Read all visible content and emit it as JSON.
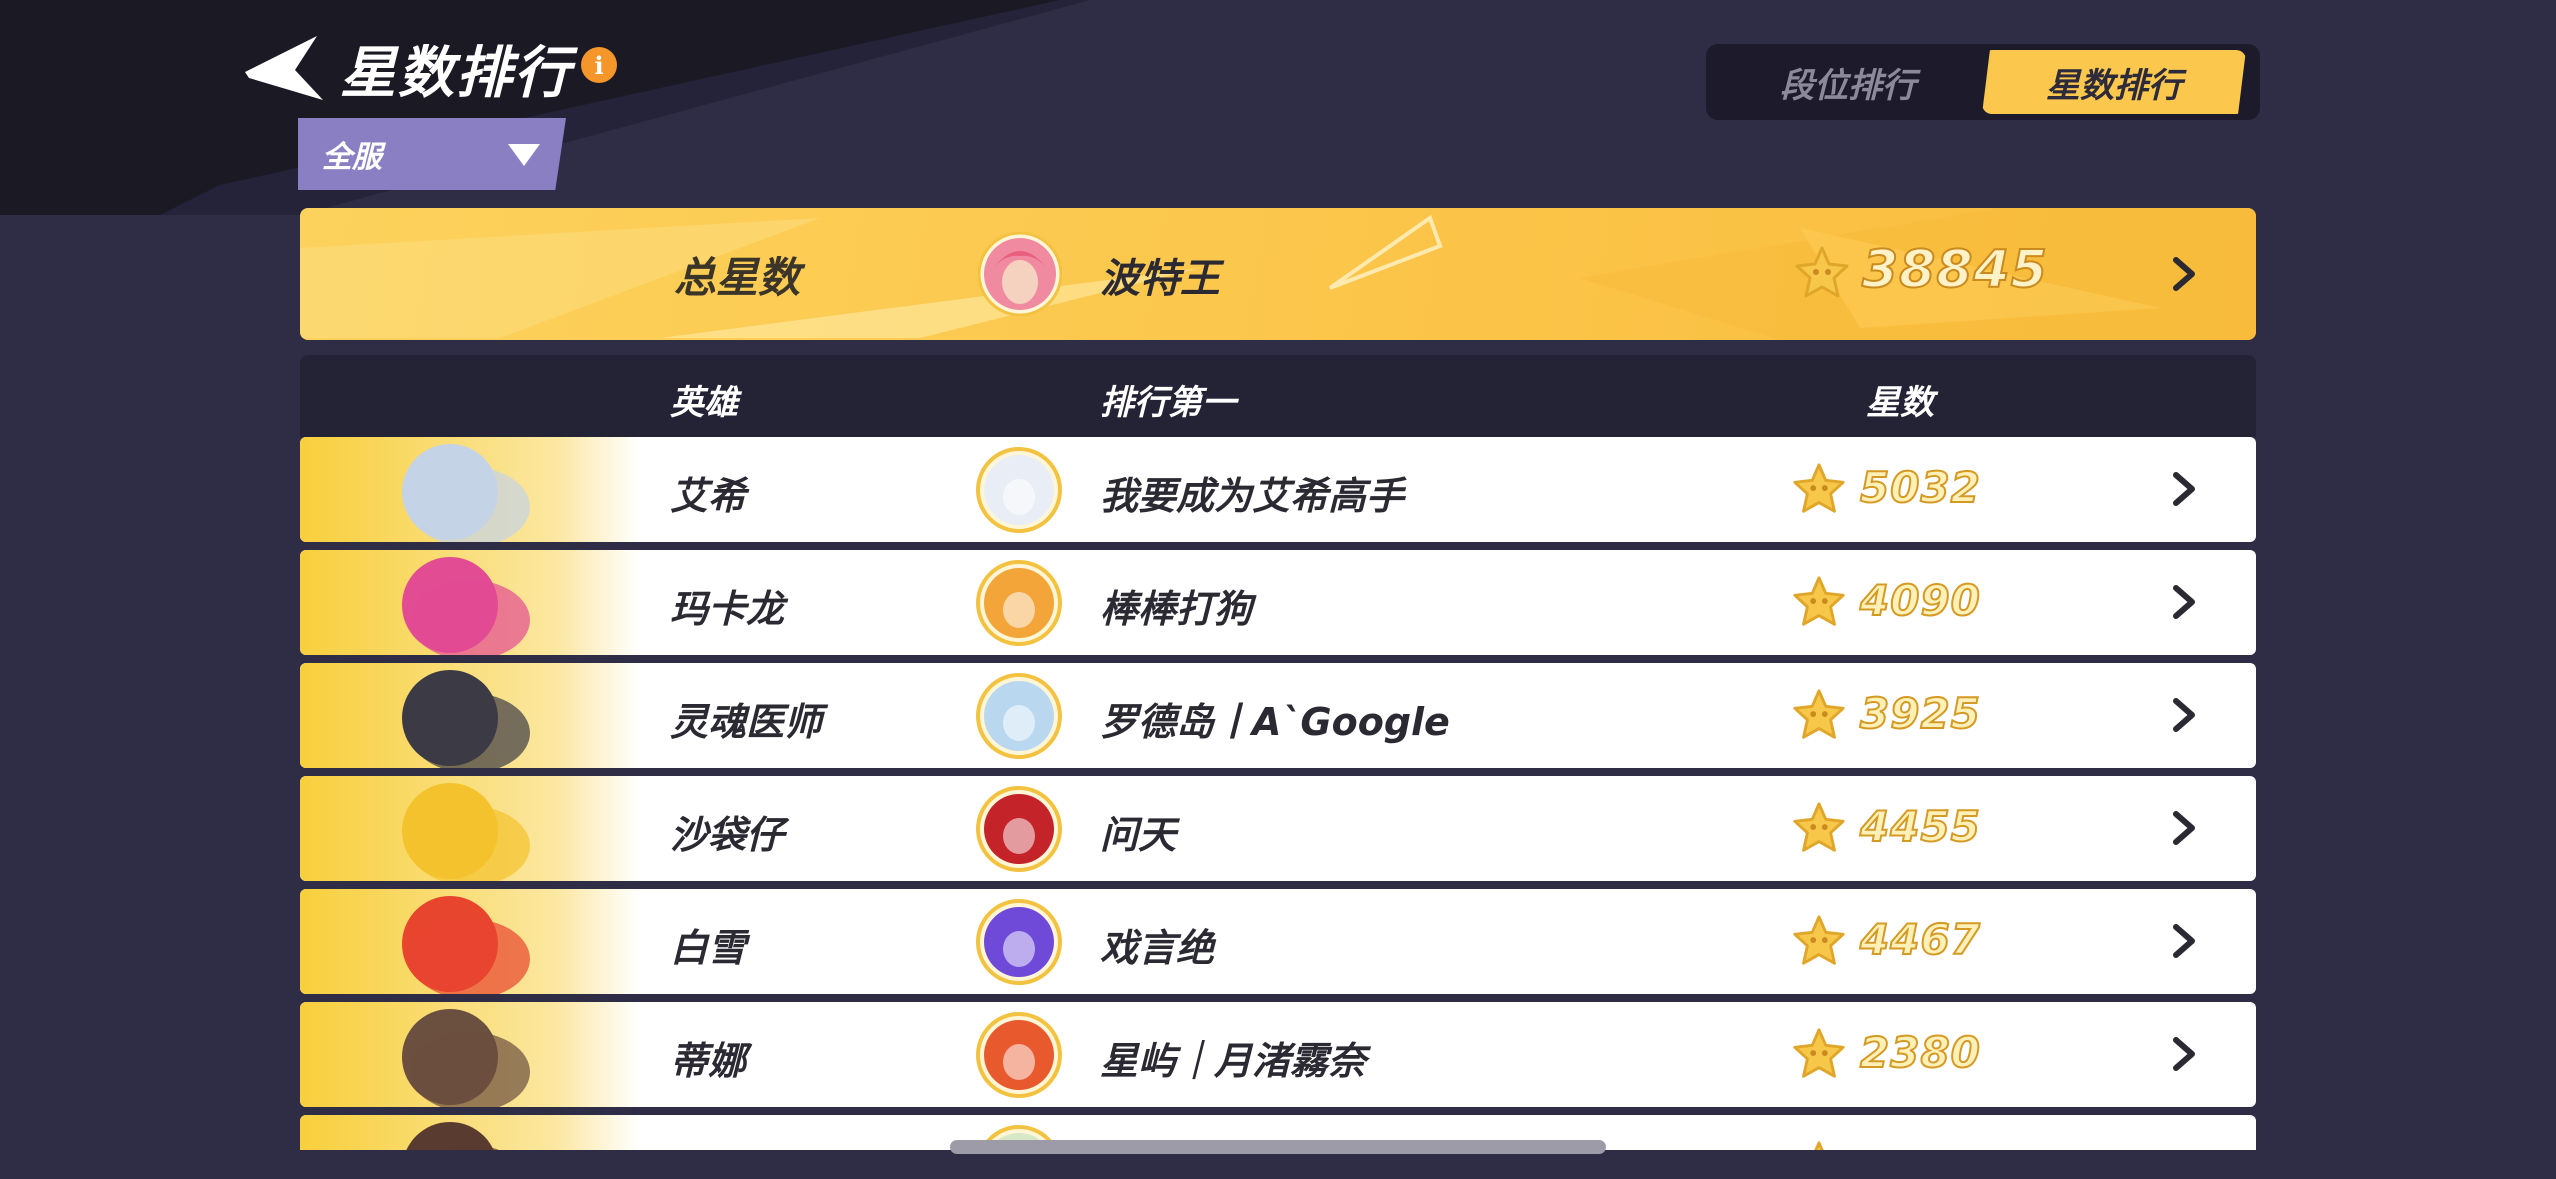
{
  "header": {
    "title": "星数排行",
    "info_icon": "info-icon",
    "server_filter": "全服"
  },
  "tabs": [
    {
      "label": "段位排行",
      "active": false
    },
    {
      "label": "星数排行",
      "active": true
    }
  ],
  "total": {
    "label": "总星数",
    "player": "波特王",
    "stars": "38845",
    "avatar_color": "#f08aa0"
  },
  "columns": {
    "hero": "英雄",
    "top_player": "排行第一",
    "stars": "星数"
  },
  "rows": [
    {
      "hero": "艾希",
      "player": "我要成为艾希高手",
      "stars": "5032",
      "hero_color": "#c5d3e6",
      "avatar_color": "#e9eef6"
    },
    {
      "hero": "玛卡龙",
      "player": "棒棒打狗",
      "stars": "4090",
      "hero_color": "#e24c93",
      "avatar_color": "#f3a53a"
    },
    {
      "hero": "灵魂医师",
      "player": "罗德岛丨A`Google",
      "stars": "3925",
      "hero_color": "#3c3a44",
      "avatar_color": "#b9d8f0"
    },
    {
      "hero": "沙袋仔",
      "player": "问天",
      "stars": "4455",
      "hero_color": "#f4c22c",
      "avatar_color": "#c4232a"
    },
    {
      "hero": "白雪",
      "player": "戏言绝",
      "stars": "4467",
      "hero_color": "#e8452f",
      "avatar_color": "#6f4ad9"
    },
    {
      "hero": "蒂娜",
      "player": "星屿｜月渚霧奈",
      "stars": "2380",
      "hero_color": "#6b4f3f",
      "avatar_color": "#e85a2e"
    },
    {
      "hero": "",
      "player": "",
      "stars": "",
      "hero_color": "#5a3b2f",
      "avatar_color": "#d7e8c7"
    }
  ],
  "colors": {
    "background": "#2f2c45",
    "accent_yellow": "#fbc84d",
    "star_gold": "#f7c74a"
  }
}
